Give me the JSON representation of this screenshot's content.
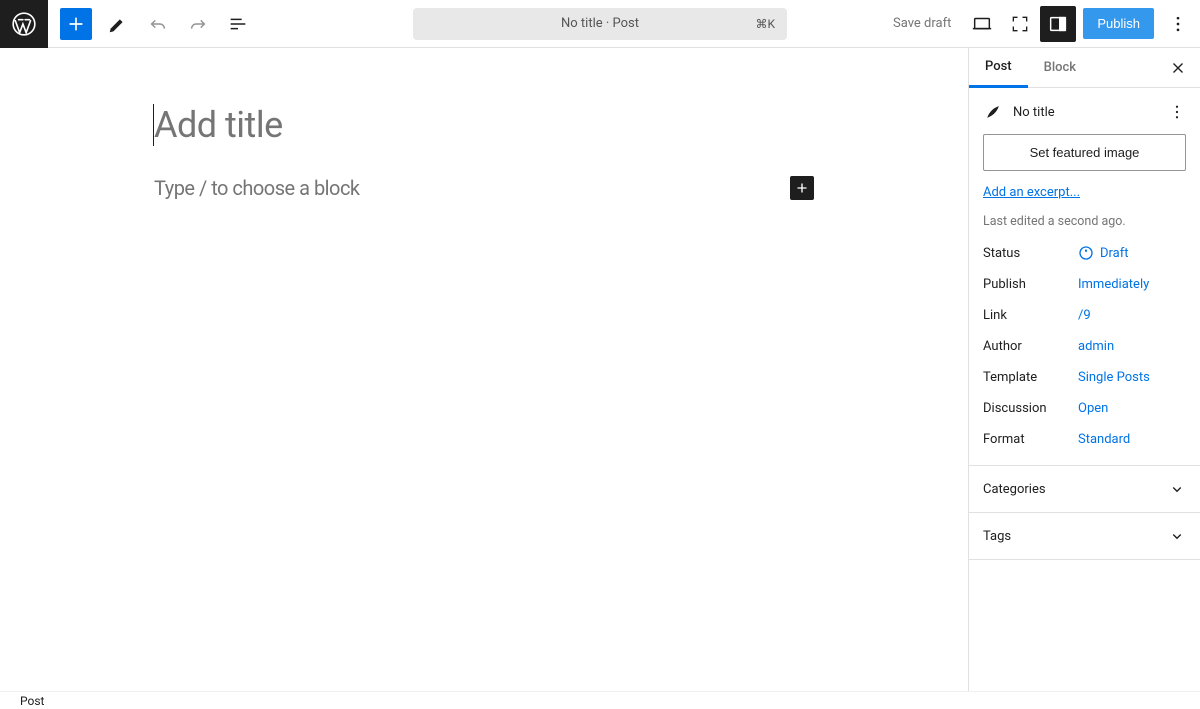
{
  "toolbar": {
    "save_draft": "Save draft",
    "publish": "Publish",
    "doc_title": "No title · Post",
    "shortcut": "⌘K"
  },
  "editor": {
    "title_placeholder": "Add title",
    "block_prompt": "Type / to choose a block"
  },
  "sidebar": {
    "tabs": {
      "post": "Post",
      "block": "Block"
    },
    "doc_title": "No title",
    "featured_image": "Set featured image",
    "excerpt_link": "Add an excerpt...",
    "last_edited": "Last edited a second ago.",
    "meta": {
      "status_label": "Status",
      "status_value": "Draft",
      "publish_label": "Publish",
      "publish_value": "Immediately",
      "link_label": "Link",
      "link_value": "/9",
      "author_label": "Author",
      "author_value": "admin",
      "template_label": "Template",
      "template_value": "Single Posts",
      "discussion_label": "Discussion",
      "discussion_value": "Open",
      "format_label": "Format",
      "format_value": "Standard"
    },
    "panels": {
      "categories": "Categories",
      "tags": "Tags"
    }
  },
  "footer": {
    "breadcrumb": "Post"
  }
}
